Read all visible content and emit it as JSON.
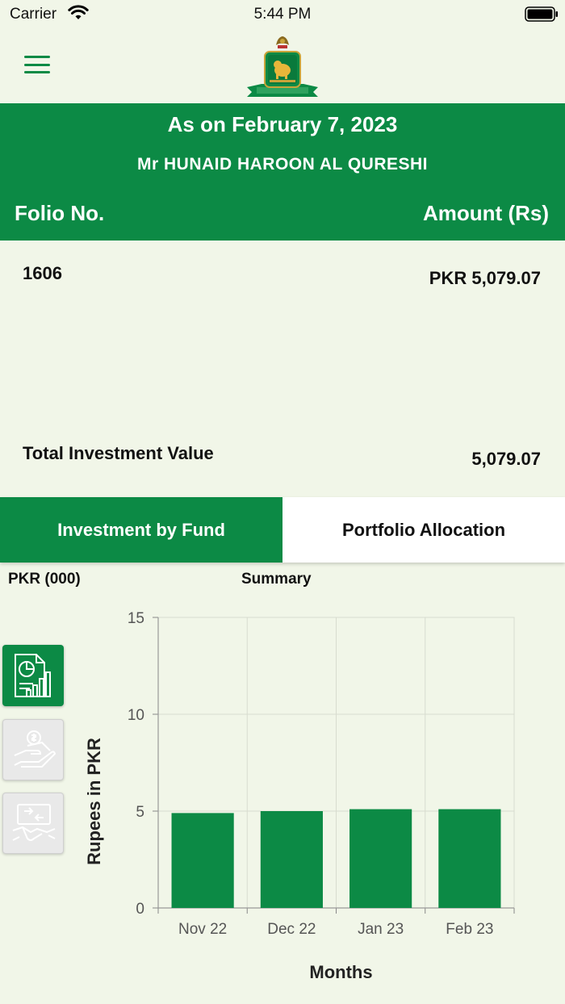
{
  "status_bar": {
    "carrier": "Carrier",
    "time": "5:44 PM"
  },
  "header": {
    "date": "As on February 7, 2023",
    "name": "Mr HUNAID HAROON AL QURESHI",
    "folio_col": "Folio No.",
    "amount_col": "Amount (Rs)"
  },
  "holdings": [
    {
      "folio": "1606",
      "amount": "PKR 5,079.07"
    }
  ],
  "total": {
    "label": "Total Investment Value",
    "value": "5,079.07"
  },
  "tabs": [
    {
      "label": "Investment by Fund",
      "active": true
    },
    {
      "label": "Portfolio Allocation",
      "active": false
    }
  ],
  "chart_meta": {
    "unit_label": "PKR (000)",
    "title": "Summary"
  },
  "side_buttons": [
    {
      "icon": "report-chart-icon",
      "active": true
    },
    {
      "icon": "money-hand-icon",
      "active": false
    },
    {
      "icon": "handshake-transfer-icon",
      "active": false
    }
  ],
  "colors": {
    "brand_green": "#0c8a45",
    "background": "#f1f6e8"
  },
  "chart_data": {
    "type": "bar",
    "title": "Summary",
    "categories": [
      "Nov 22",
      "Dec 22",
      "Jan 23",
      "Feb 23"
    ],
    "values": [
      4.9,
      5.0,
      5.1,
      5.1
    ],
    "xlabel": "Months",
    "ylabel": "Rupees in PKR",
    "ylim": [
      0,
      15
    ],
    "yticks": [
      0,
      5,
      10,
      15
    ],
    "grid": true,
    "bar_color": "#0c8a45"
  }
}
